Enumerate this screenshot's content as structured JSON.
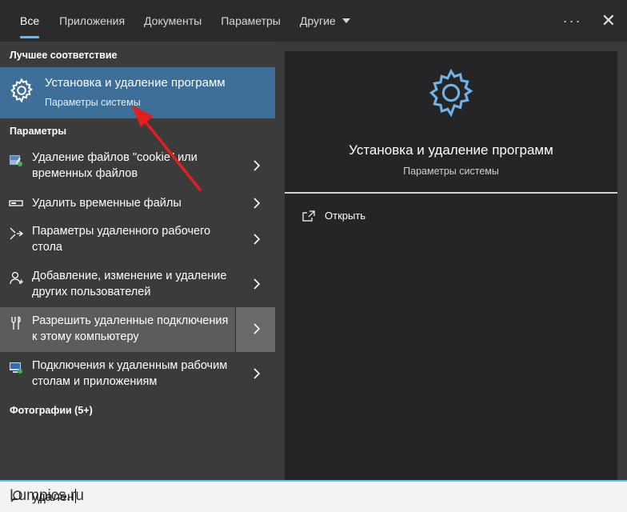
{
  "tabs": [
    {
      "label": "Все",
      "active": true
    },
    {
      "label": "Приложения"
    },
    {
      "label": "Документы"
    },
    {
      "label": "Параметры"
    },
    {
      "label": "Другие"
    }
  ],
  "header": {
    "more": "···",
    "close": "✕"
  },
  "best_match": {
    "heading": "Лучшее соответствие",
    "title": "Установка и удаление программ",
    "subtitle": "Параметры системы"
  },
  "settings_heading": "Параметры",
  "results": [
    {
      "icon": "disk-cleanup-icon",
      "text": "Удаление файлов \"cookie\" или временных файлов"
    },
    {
      "icon": "storage-icon",
      "text": "Удалить временные файлы"
    },
    {
      "icon": "remote-desktop-icon",
      "text": "Параметры удаленного рабочего стола"
    },
    {
      "icon": "user-icon",
      "text": "Добавление, изменение и удаление других пользователей"
    },
    {
      "icon": "remote-connection-icon",
      "text": "Разрешить удаленные подключения к этому компьютеру"
    },
    {
      "icon": "remote-apps-icon",
      "text": "Подключения к удаленным рабочим столам и приложениям"
    }
  ],
  "photos_heading": "Фотографии (5+)",
  "preview": {
    "title": "Установка и удаление программ",
    "subtitle": "Параметры системы",
    "open_label": "Открыть"
  },
  "search": {
    "query": "удален",
    "watermark": "Lumpics.ru"
  },
  "colors": {
    "accent": "#4cc2ff",
    "selected": "#3d6f98",
    "arrow": "#e02020"
  }
}
